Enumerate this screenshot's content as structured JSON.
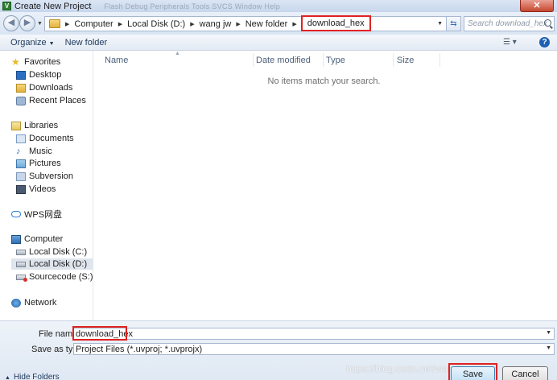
{
  "window": {
    "title": "Create New Project",
    "close_glyph": "✕",
    "ghost_menu": "Flash Debug Peripherals Tools SVCS Window Help"
  },
  "address": {
    "breadcrumbs": [
      "Computer",
      "Local Disk (D:)",
      "wang jw",
      "New folder",
      "download_hex"
    ],
    "search_placeholder": "Search download_hex"
  },
  "toolbar": {
    "organize": "Organize",
    "new_folder": "New folder"
  },
  "nav": {
    "favorites": "Favorites",
    "favorites_items": [
      "Desktop",
      "Downloads",
      "Recent Places"
    ],
    "libraries": "Libraries",
    "libraries_items": [
      "Documents",
      "Music",
      "Pictures",
      "Subversion",
      "Videos"
    ],
    "wps": "WPS网盘",
    "computer": "Computer",
    "computer_items": [
      "Local Disk (C:)",
      "Local Disk (D:)",
      "Sourcecode (S:)"
    ],
    "network": "Network"
  },
  "list": {
    "columns": [
      "Name",
      "Date modified",
      "Type",
      "Size"
    ],
    "empty_message": "No items match your search."
  },
  "form": {
    "filename_label": "File name:",
    "filename_value": "download_hex",
    "savetype_label": "Save as type:",
    "savetype_value": "Project Files (*.uvproj; *.uvprojx)",
    "hide_folders": "Hide Folders",
    "save": "Save",
    "cancel": "Cancel"
  },
  "watermark": "https://blog.csdn.net/wangjiawaiwai",
  "colors": {
    "highlight": "#e02222",
    "selected_bg": "#dfe5ed"
  }
}
